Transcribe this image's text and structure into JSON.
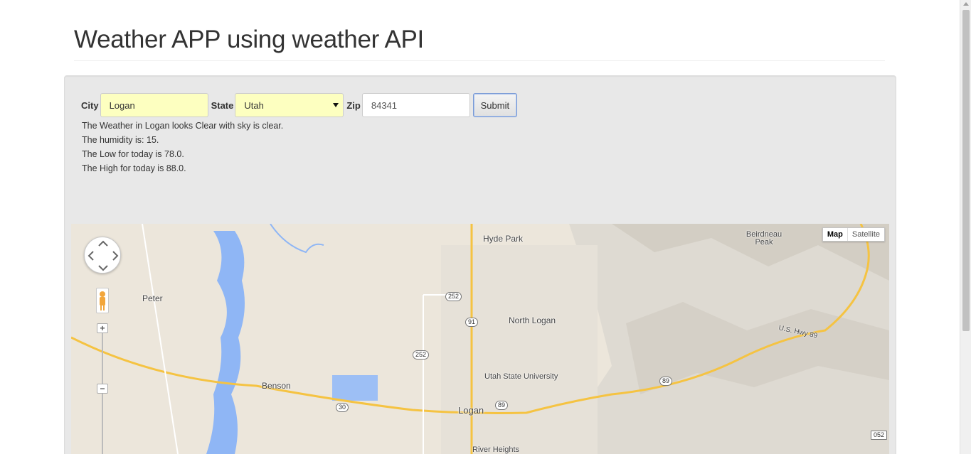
{
  "header": {
    "title": "Weather APP using weather API"
  },
  "form": {
    "city_label": "City",
    "city_value": "Logan",
    "state_label": "State",
    "state_value": "Utah",
    "zip_label": "Zip",
    "zip_value": "84341",
    "submit_label": "Submit"
  },
  "results": {
    "line1": "The Weather in Logan looks Clear with sky is clear.",
    "line2": "The humidity is: 15.",
    "line3": "The Low for today is 78.0.",
    "line4": "The High for today is 88.0."
  },
  "map": {
    "type_map": "Map",
    "type_satellite": "Satellite",
    "zoom_in": "+",
    "zoom_out": "−",
    "places": {
      "hyde_park": "Hyde Park",
      "north_logan": "North Logan",
      "peter": "Peter",
      "benson": "Benson",
      "usu": "Utah State University",
      "logan": "Logan",
      "river_heights": "River Heights",
      "beirdneau": "Beirdneau Peak",
      "hwy89": "U.S. Hwy 89"
    },
    "routes": {
      "r252a": "252",
      "r252b": "252",
      "r91": "91",
      "r89a": "89",
      "r89b": "89",
      "r30": "30",
      "r052": "052"
    },
    "colors": {
      "land": "#ece6db",
      "water": "#8fb6f5",
      "road": "#f5c342",
      "terrain": "#d9d4cb"
    }
  }
}
